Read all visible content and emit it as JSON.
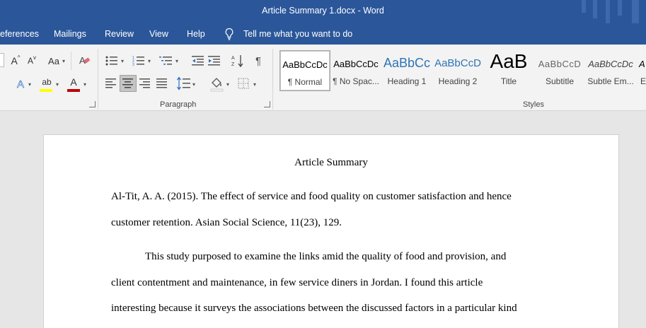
{
  "window": {
    "title": "Article Summary 1.docx  -  Word"
  },
  "menu": {
    "tabs": [
      "eferences",
      "Mailings",
      "Review",
      "View",
      "Help"
    ],
    "tell_me": "Tell me what you want to do"
  },
  "ribbon": {
    "font": {
      "grow": "A",
      "shrink": "A",
      "change_case": "Aa",
      "text_effects": "A",
      "highlight_text": "ab",
      "font_color": "A"
    },
    "paragraph": {
      "label": "Paragraph",
      "pilcrow": "¶"
    },
    "styles": {
      "label": "Styles",
      "items": [
        {
          "sample": "AaBbCcDc",
          "name": "¶ Normal"
        },
        {
          "sample": "AaBbCcDc",
          "name": "¶ No Spac..."
        },
        {
          "sample": "AaBbCc",
          "name": "Heading 1"
        },
        {
          "sample": "AaBbCcD",
          "name": "Heading 2"
        },
        {
          "sample": "AaB",
          "name": "Title"
        },
        {
          "sample": "AaBbCcD",
          "name": "Subtitle"
        },
        {
          "sample": "AaBbCcDc",
          "name": "Subtle Em..."
        },
        {
          "sample": "A",
          "name": "E"
        }
      ]
    },
    "colors": {
      "highlight": "#ffff00",
      "font_color": "#c00000"
    }
  },
  "document": {
    "title": "Article Summary",
    "reference_line1": "Al-Tit, A. A. (2015). The effect of service and food quality on customer satisfaction and hence",
    "reference_line2": "customer retention. Asian Social Science, 11(23), 129.",
    "para_line1": "This study purposed to examine the links amid the quality of food and provision, and",
    "para_line2": "client contentment and maintenance, in few service diners in Jordan. I found this article",
    "para_line3": "interesting because it surveys the associations between the discussed factors in a particular kind"
  }
}
